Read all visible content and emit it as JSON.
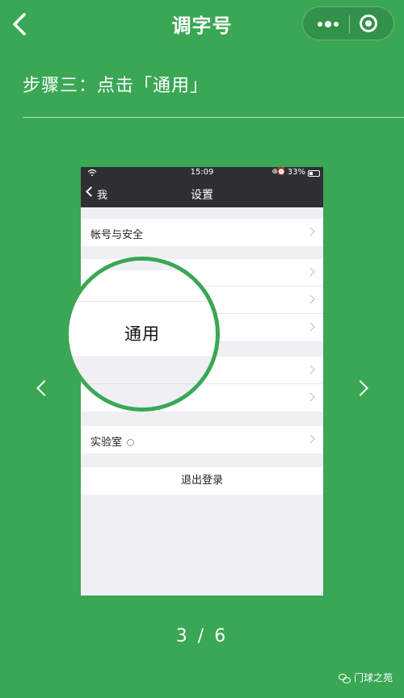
{
  "navbar": {
    "title": "调字号",
    "back_icon": "chevron-left-icon",
    "more_icon": "more-dots-icon",
    "close_icon": "close-circle-icon"
  },
  "step": {
    "title": "步骤三：点击「通用」"
  },
  "phone": {
    "status_time": "15:09",
    "battery": "33%",
    "back_label": "我",
    "title": "设置",
    "rows": [
      {
        "label": "帐号与安全"
      },
      {
        "label": "实验室"
      }
    ],
    "logout_label": "退出登录",
    "magnified_label": "通用"
  },
  "pager": {
    "text": "3 / 6"
  },
  "footer": {
    "label": "门球之苑"
  },
  "colors": {
    "background": "#3aa754",
    "phone_header": "#2f2f33"
  }
}
